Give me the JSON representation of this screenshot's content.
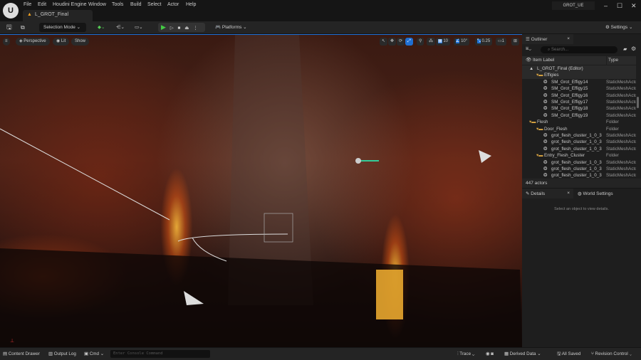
{
  "menu": [
    "File",
    "Edit",
    "Houdini Engine",
    "Window",
    "Tools",
    "Build",
    "Select",
    "Actor",
    "Help"
  ],
  "level_tab": "L_GROT_Final",
  "project": "GROT_UE",
  "window_controls": {
    "minimize": "–",
    "maximize": "☐",
    "close": "✕"
  },
  "toolbar": {
    "selection_mode": "Selection Mode",
    "platforms": "Platforms",
    "settings": "Settings"
  },
  "viewport": {
    "perspective": "Perspective",
    "lit": "Lit",
    "show": "Show",
    "grid_snap": "10",
    "rotation_snap": "10°",
    "scale_snap": "0.25",
    "camera_speed": "1"
  },
  "outliner": {
    "title": "Outliner",
    "search_placeholder": "Search...",
    "col_label": "Item Label",
    "col_type": "Type",
    "rows": [
      {
        "label": "L_GROT_Final (Editor)",
        "type": "",
        "indent": 1,
        "kind": "level"
      },
      {
        "label": "Effigies",
        "type": "",
        "indent": 2,
        "kind": "folder"
      },
      {
        "label": "SM_Grot_Effigy14",
        "type": "StaticMeshActor",
        "indent": 3,
        "kind": "mesh"
      },
      {
        "label": "SM_Grot_Effigy15",
        "type": "StaticMeshActor",
        "indent": 3,
        "kind": "mesh"
      },
      {
        "label": "SM_Grot_Effigy16",
        "type": "StaticMeshActor",
        "indent": 3,
        "kind": "mesh"
      },
      {
        "label": "SM_Grot_Effigy17",
        "type": "StaticMeshActor",
        "indent": 3,
        "kind": "mesh"
      },
      {
        "label": "SM_Grot_Effigy18",
        "type": "StaticMeshActor",
        "indent": 3,
        "kind": "mesh"
      },
      {
        "label": "SM_Grot_Effigy19",
        "type": "StaticMeshActor",
        "indent": 3,
        "kind": "mesh"
      },
      {
        "label": "Flesh",
        "type": "Folder",
        "indent": 1,
        "kind": "folder"
      },
      {
        "label": "Door_Flesh",
        "type": "Folder",
        "indent": 2,
        "kind": "folder"
      },
      {
        "label": "grot_flesh_cluster_1_0_3",
        "type": "StaticMeshActor",
        "indent": 3,
        "kind": "mesh"
      },
      {
        "label": "grot_flesh_cluster_1_0_3",
        "type": "StaticMeshActor",
        "indent": 3,
        "kind": "mesh"
      },
      {
        "label": "grot_flesh_cluster_1_0_3",
        "type": "StaticMeshActor",
        "indent": 3,
        "kind": "mesh"
      },
      {
        "label": "Entry_Flesh_Cluster",
        "type": "Folder",
        "indent": 2,
        "kind": "folder"
      },
      {
        "label": "grot_flesh_cluster_1_0_3",
        "type": "StaticMeshActor",
        "indent": 3,
        "kind": "mesh"
      },
      {
        "label": "grot_flesh_cluster_1_0_3",
        "type": "StaticMeshActor",
        "indent": 3,
        "kind": "mesh"
      },
      {
        "label": "grot_flesh_cluster_1_0_3",
        "type": "StaticMeshActor",
        "indent": 3,
        "kind": "mesh"
      }
    ],
    "count": "447 actors"
  },
  "details": {
    "tab": "Details",
    "world_settings": "World Settings",
    "empty": "Select an object to view details."
  },
  "bottom": {
    "content_drawer": "Content Drawer",
    "output_log": "Output Log",
    "cmd": "Cmd",
    "console_placeholder": "Enter Console Command",
    "trace": "Trace",
    "derived_data": "Derived Data",
    "all_saved": "All Saved",
    "revision_control": "Revision Control"
  }
}
